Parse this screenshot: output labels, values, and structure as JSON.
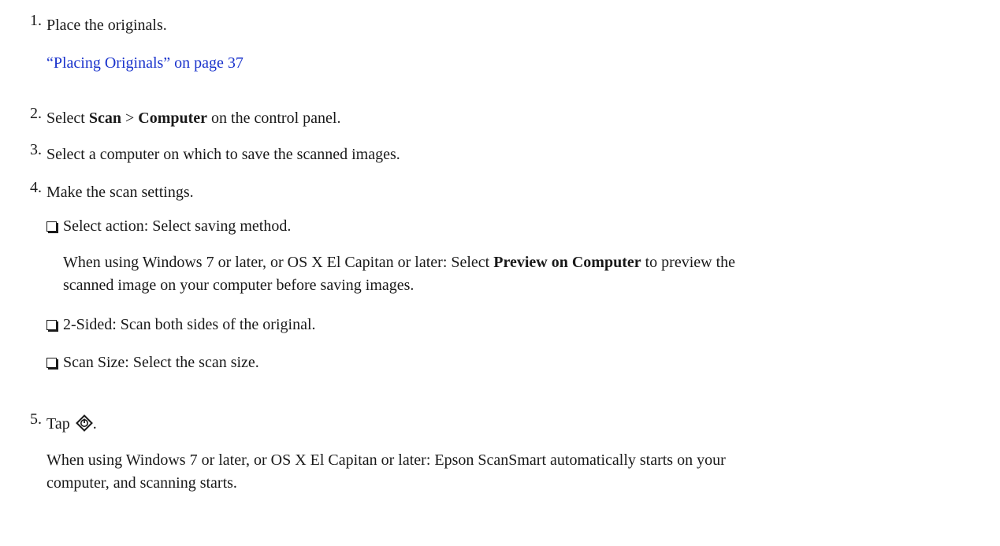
{
  "steps": [
    {
      "number": "1.",
      "text": "Place the originals.",
      "link": "“Placing Originals” on page 37"
    },
    {
      "number": "2.",
      "text_before": "Select ",
      "bold1": "Scan",
      "sep": " > ",
      "bold2": "Computer",
      "text_after": " on the control panel."
    },
    {
      "number": "3.",
      "text": "Select a computer on which to save the scanned images."
    },
    {
      "number": "4.",
      "text": "Make the scan settings.",
      "options": [
        {
          "text": "Select action: Select saving method.",
          "note_before": "When using Windows 7 or later, or OS X El Capitan or later: Select ",
          "note_bold": "Preview on Computer",
          "note_after": " to preview the",
          "note_line2": "scanned image on your computer before saving images."
        },
        {
          "text": "2-Sided: Scan both sides of the original."
        },
        {
          "text": "Scan Size: Select the scan size."
        }
      ]
    },
    {
      "number": "5.",
      "text_before": "Tap ",
      "icon": "start-diamond-icon",
      "text_after": ".",
      "note_line1": "When using Windows 7 or later, or OS X El Capitan or later: Epson ScanSmart automatically starts on your",
      "note_line2": "computer, and scanning starts."
    }
  ]
}
